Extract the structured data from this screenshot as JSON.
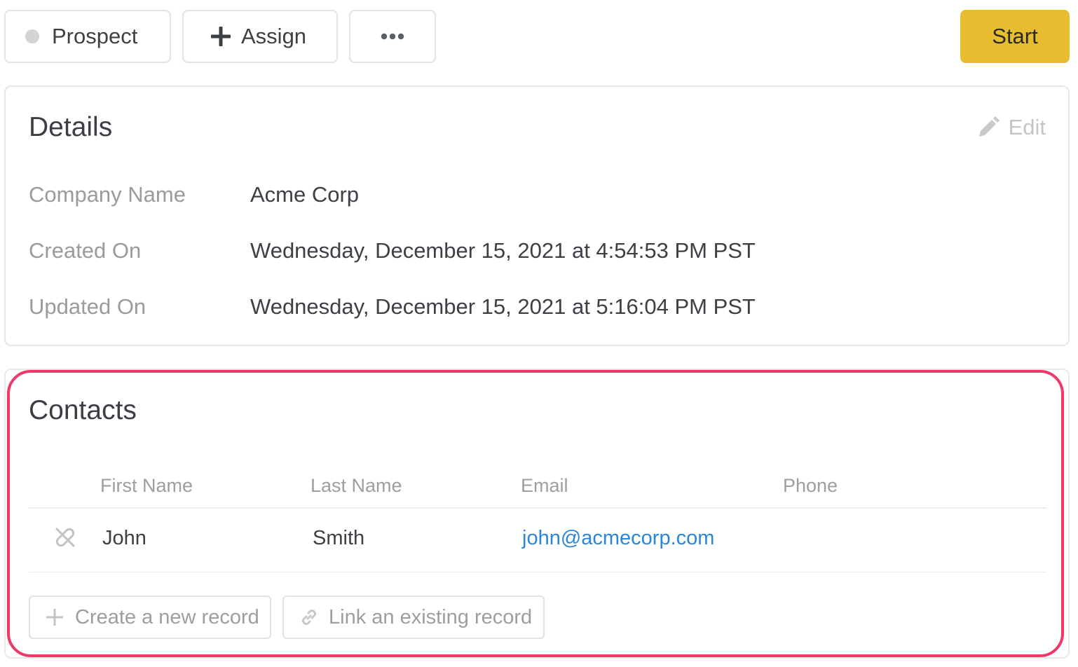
{
  "toolbar": {
    "status_label": "Prospect",
    "assign_label": "Assign",
    "start_label": "Start",
    "status_dot_color": "#d3d3d6",
    "start_color": "#e8bd2f"
  },
  "details": {
    "title": "Details",
    "edit_label": "Edit",
    "fields": [
      {
        "label": "Company Name",
        "value": "Acme Corp"
      },
      {
        "label": "Created On",
        "value": "Wednesday, December 15, 2021 at 4:54:53 PM PST"
      },
      {
        "label": "Updated On",
        "value": "Wednesday, December 15, 2021 at 5:16:04 PM PST"
      }
    ]
  },
  "contacts": {
    "title": "Contacts",
    "highlight_color": "#f0386b",
    "columns": [
      "First Name",
      "Last Name",
      "Email",
      "Phone"
    ],
    "rows": [
      {
        "first_name": "John",
        "last_name": "Smith",
        "email": "john@acmecorp.com",
        "phone": ""
      }
    ],
    "create_label": "Create a new record",
    "link_label": "Link an existing record"
  }
}
